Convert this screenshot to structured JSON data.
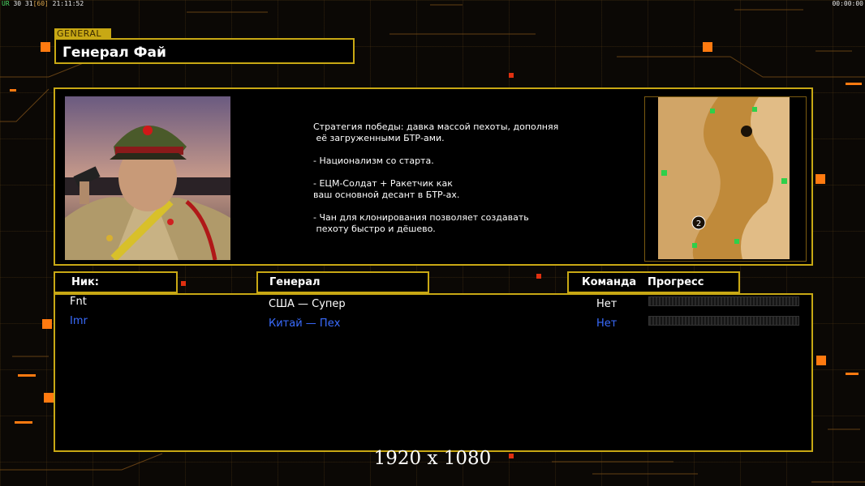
{
  "osd": {
    "fps": "30 31",
    "fps_cap": "[60]",
    "clock": "21:11:52",
    "timer": "00:00:00",
    "tag": "UR"
  },
  "header": {
    "tag": "GENERAL",
    "title": "Генерал Фай"
  },
  "description": [
    "Стратегия победы: давка массой пехоты, дополняя\n её загруженными БТР-ами.",
    "- Национализм со старта.",
    "- ЕЦМ-Солдат + Ракетчик как\nваш основной десант в БТР-ах.",
    "- Чан для клонирования позволяет создавать\n пехоту быстро и дёшево."
  ],
  "columns": {
    "nick": "Ник:",
    "general": "Генерал",
    "team": "Команда",
    "progress": "Прогресс"
  },
  "players": [
    {
      "nick": "Fnt",
      "general": "США — Супер",
      "team": "Нет",
      "progress": 0,
      "color": "#ffffff"
    },
    {
      "nick": "Imr",
      "general": "Китай — Пех",
      "team": "Нет",
      "progress": 0,
      "color": "#3a6cff"
    }
  ],
  "minimap": {
    "markers": [
      "1",
      "2"
    ]
  },
  "resolution": "1920 x 1080",
  "colors": {
    "frame": "#c8a814",
    "accent": "#ff7a10"
  }
}
